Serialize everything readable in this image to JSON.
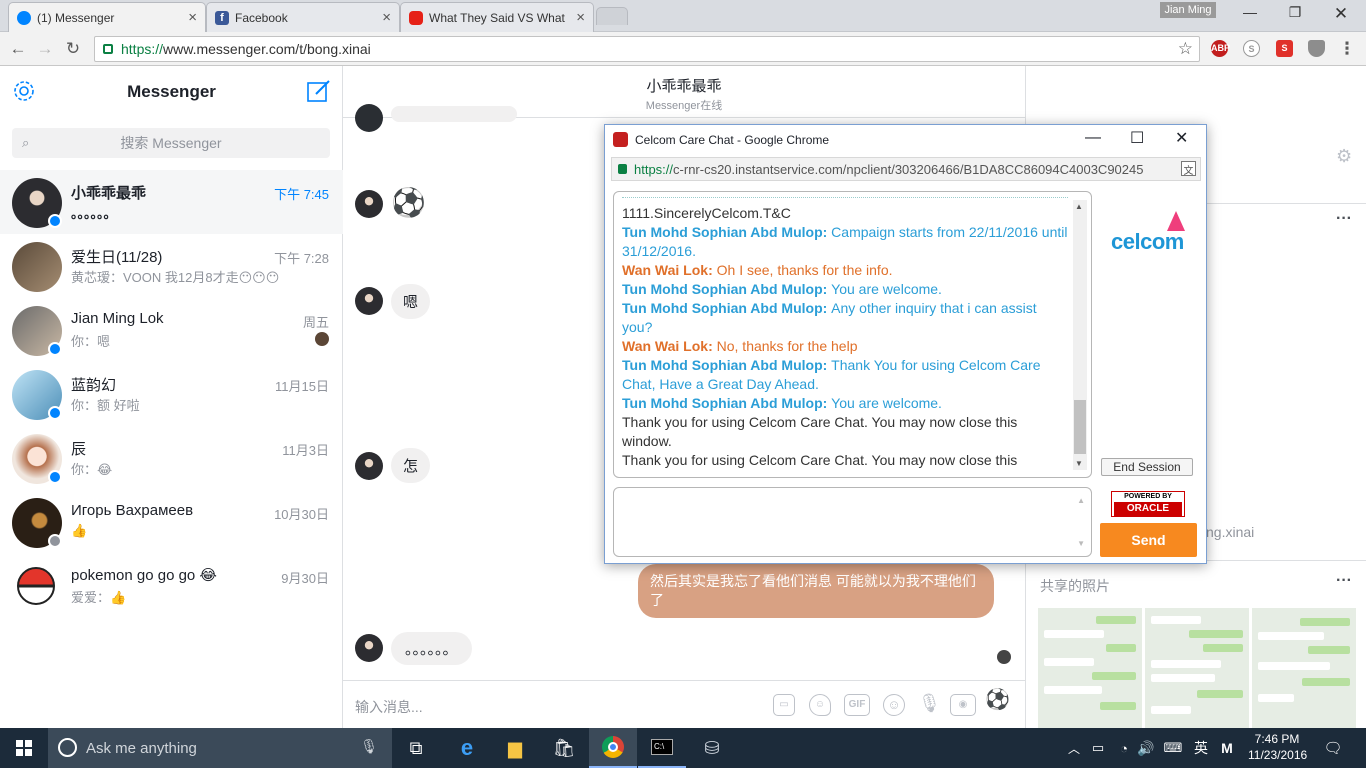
{
  "browser": {
    "tabs": [
      {
        "label": "(1) Messenger",
        "favicon_color": "#0084ff"
      },
      {
        "label": "Facebook",
        "favicon_color": "#3b5998"
      },
      {
        "label": "What They Said VS What",
        "favicon_color": "#e62117"
      }
    ],
    "profile_name": "Jian Ming",
    "url": "https://www.messenger.com/t/bong.xinai",
    "url_https": "https://",
    "url_rest": "www.messenger.com/t/bong.xinai",
    "extensions": [
      "ABP",
      "S"
    ]
  },
  "messenger": {
    "title": "Messenger",
    "search_placeholder": "搜索 Messenger",
    "conversations": [
      {
        "name": "小乖乖最乖",
        "snippet": "。。。。。。",
        "time": "下午 7:45",
        "selected": true
      },
      {
        "name": "爱生日(11/28)",
        "snippet": "黄芯瑷：VOON 我12月8才走😶😶😶",
        "time": "下午 7:28"
      },
      {
        "name": "Jian Ming Lok",
        "snippet": "你：嗯",
        "time": "周五"
      },
      {
        "name": "蓝韵幻",
        "snippet": "你：额 好啦",
        "time": "11月15日"
      },
      {
        "name": "辰",
        "snippet": "你：😂",
        "time": "11月3日"
      },
      {
        "name": "Игорь Вахрамеев",
        "snippet": "👍",
        "time": "10月30日"
      },
      {
        "name": "pokemon go go go 😂",
        "snippet": "爱爱：👍",
        "time": "9月30日"
      }
    ]
  },
  "chat": {
    "name": "小乖乖最乖",
    "status": "Messenger在线",
    "messages": {
      "m1": "⚽",
      "m2": "嗯",
      "m3": "怎",
      "mine": "然后其实是我忘了看他们消息 可能就以为我不理他们了",
      "m4": "。。。。。。"
    },
    "composer_placeholder": "输入消息...",
    "gif_label": "GIF"
  },
  "right_panel": {
    "shared_photos_label": "共享的照片",
    "username_partial": "ng.xinai"
  },
  "popup": {
    "window_title": "Celcom Care Chat - Google Chrome",
    "url": "https://c-rnr-cs20.instantservice.com/npclient/303206466/B1DA8CC86094C4003C90245",
    "url_https": "https://",
    "url_rest": "c-rnr-cs20.instantservice.com/npclient/303206466/B1DA8CC86094C4003C90245",
    "brand": "celcom",
    "transcript": [
      {
        "speaker": "",
        "text": "1111.SincerelyCelcom.T&C",
        "type": "plain"
      },
      {
        "speaker": "Tun Mohd Sophian Abd Mulop:",
        "text": "Campaign starts from 22/11/2016 until 31/12/2016.",
        "type": "agent"
      },
      {
        "speaker": "Wan Wai Lok:",
        "text": "Oh I see, thanks for the info.",
        "type": "cust"
      },
      {
        "speaker": "Tun Mohd Sophian Abd Mulop:",
        "text": "You are welcome.",
        "type": "agent"
      },
      {
        "speaker": "Tun Mohd Sophian Abd Mulop:",
        "text": "Any other inquiry that i can assist you?",
        "type": "agent"
      },
      {
        "speaker": "Wan Wai Lok:",
        "text": "No, thanks for the help",
        "type": "cust"
      },
      {
        "speaker": "Tun Mohd Sophian Abd Mulop:",
        "text": "Thank You for using Celcom Care Chat, Have a Great Day Ahead.",
        "type": "agent"
      },
      {
        "speaker": "Tun Mohd Sophian Abd Mulop:",
        "text": "You are welcome.",
        "type": "agent"
      },
      {
        "speaker": "",
        "text": "Thank you for using Celcom Care Chat. You may now close this window.",
        "type": "plain"
      },
      {
        "speaker": "",
        "text": "Thank you for using Celcom Care Chat. You may now close this",
        "type": "plain"
      }
    ],
    "end_session_label": "End Session",
    "powered_by": "POWERED BY",
    "oracle": "ORACLE",
    "send_label": "Send"
  },
  "taskbar": {
    "search_placeholder": "Ask me anything",
    "ime": "英",
    "ime2": "M",
    "time": "7:46 PM",
    "date": "11/23/2016"
  }
}
